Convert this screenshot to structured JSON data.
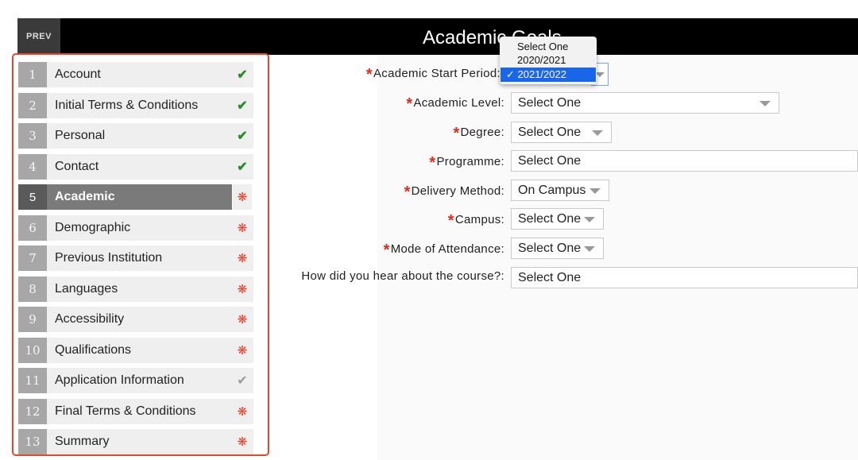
{
  "header": {
    "prev_label": "PREV",
    "title": "Academic Goals"
  },
  "sidebar": {
    "steps": [
      {
        "num": "1",
        "label": "Account",
        "status": "✔"
      },
      {
        "num": "2",
        "label": "Initial Terms & Conditions",
        "status": "✔"
      },
      {
        "num": "3",
        "label": "Personal",
        "status": "✔"
      },
      {
        "num": "4",
        "label": "Contact",
        "status": "✔"
      },
      {
        "num": "5",
        "label": "Academic",
        "status": "❋"
      },
      {
        "num": "6",
        "label": "Demographic",
        "status": "❋"
      },
      {
        "num": "7",
        "label": "Previous Institution",
        "status": "❋"
      },
      {
        "num": "8",
        "label": "Languages",
        "status": "❋"
      },
      {
        "num": "9",
        "label": "Accessibility",
        "status": "❋"
      },
      {
        "num": "10",
        "label": "Qualifications",
        "status": "❋"
      },
      {
        "num": "11",
        "label": "Application Information",
        "status": "✔"
      },
      {
        "num": "12",
        "label": "Final Terms & Conditions",
        "status": "❋"
      },
      {
        "num": "13",
        "label": "Summary",
        "status": "❋"
      }
    ],
    "active_step": "5"
  },
  "form": {
    "required_mark": "*",
    "fields": [
      {
        "label": "Academic Start Period:",
        "value": "2021/2022",
        "required": true
      },
      {
        "label": "Academic Level:",
        "value": "Select One",
        "required": true
      },
      {
        "label": "Degree:",
        "value": "Select One",
        "required": true
      },
      {
        "label": "Programme:",
        "value": "Select One",
        "required": true
      },
      {
        "label": "Delivery Method:",
        "value": "On Campus",
        "required": true
      },
      {
        "label": "Campus:",
        "value": "Select One",
        "required": true
      },
      {
        "label": "Mode of Attendance:",
        "value": "Select One",
        "required": true
      },
      {
        "label": "How did you hear about the course?:",
        "value": "Select One",
        "required": false
      }
    ]
  },
  "dropdown": {
    "options": [
      "Select One",
      "2020/2021",
      "2021/2022"
    ],
    "selected": "✓ 2021/2022"
  },
  "colors": {
    "accent": "#1a66e8",
    "required": "#e02a1a",
    "complete": "#2a8b2a",
    "highlight_border": "#e8452e"
  }
}
